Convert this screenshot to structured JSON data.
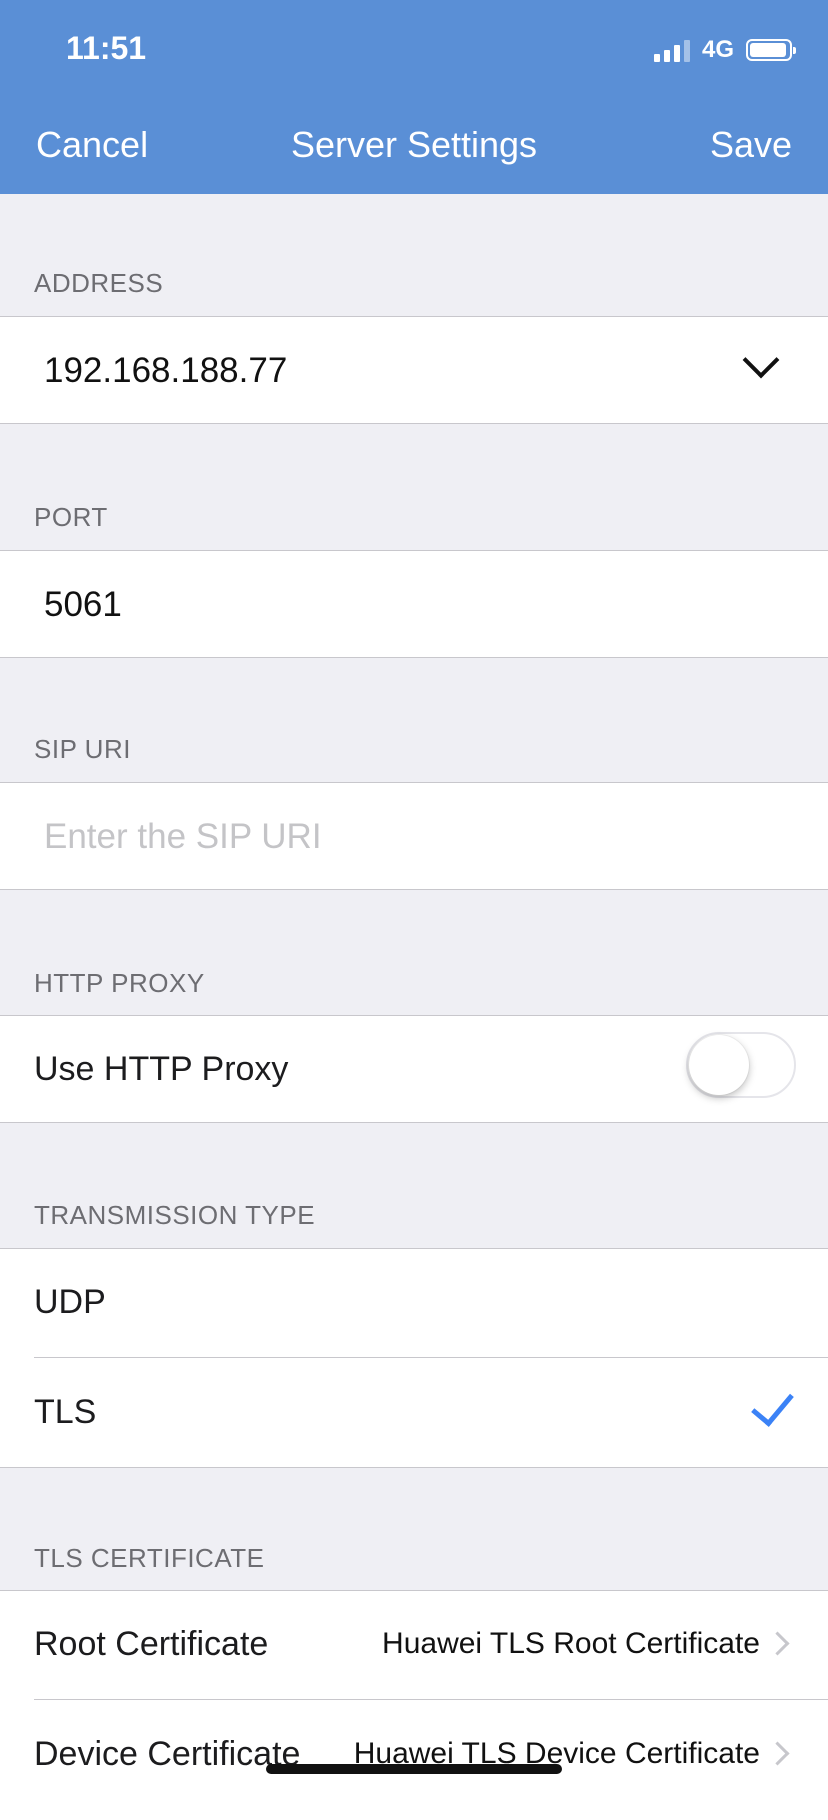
{
  "status_bar": {
    "time": "11:51",
    "network": "4G",
    "battery_level": 0.95
  },
  "nav": {
    "cancel": "Cancel",
    "title": "Server Settings",
    "save": "Save"
  },
  "address": {
    "label": "ADDRESS",
    "value": "192.168.188.77",
    "icon": "chevron-down-icon"
  },
  "port": {
    "label": "PORT",
    "value": "5061"
  },
  "sip_uri": {
    "label": "SIP URI",
    "placeholder": "Enter the SIP URI",
    "value": ""
  },
  "http_proxy": {
    "label": "HTTP PROXY",
    "toggle_label": "Use HTTP Proxy",
    "enabled": false
  },
  "transmission": {
    "label": "TRANSMISSION TYPE",
    "options": [
      {
        "label": "UDP",
        "selected": false
      },
      {
        "label": "TLS",
        "selected": true
      }
    ],
    "check_color": "#3b82f6"
  },
  "tls_certificate": {
    "label": "TLS CERTIFICATE",
    "root": {
      "label": "Root Certificate",
      "value": "Huawei TLS Root Certificate"
    },
    "device": {
      "label": "Device Certificate",
      "value": "Huawei TLS Device Certificate"
    }
  },
  "colors": {
    "header": "#5a8fd6",
    "background": "#efeff4"
  }
}
